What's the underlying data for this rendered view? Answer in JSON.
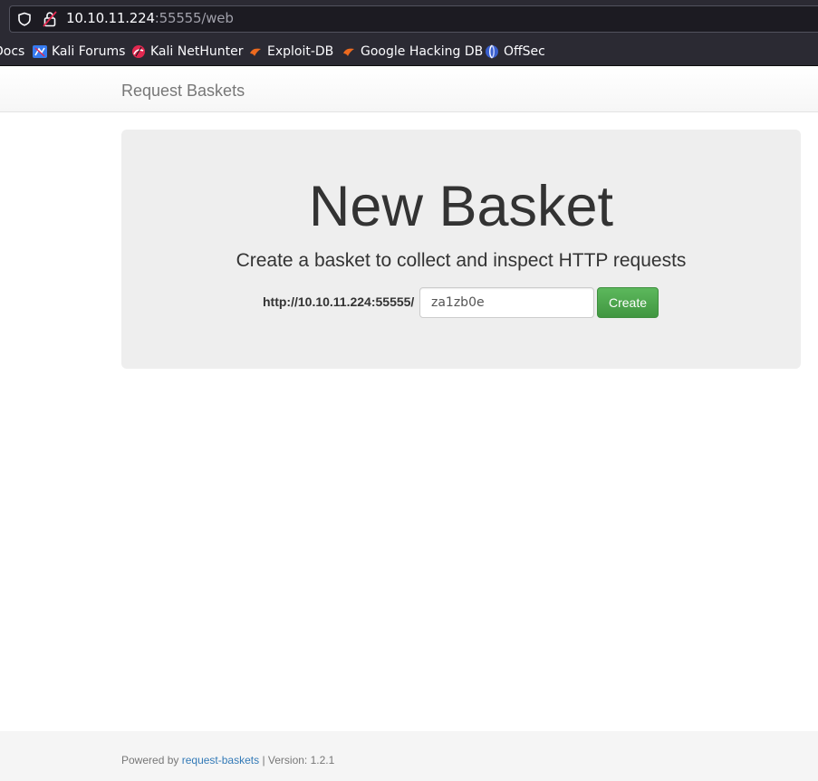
{
  "browser": {
    "url_host": "10.10.11.224",
    "url_rest": ":55555/web",
    "bookmarks": [
      {
        "label": "Docs",
        "icon": "docs-icon"
      },
      {
        "label": "Kali Forums",
        "icon": "kali-forums-icon"
      },
      {
        "label": "Kali NetHunter",
        "icon": "kali-nethunter-icon"
      },
      {
        "label": "Exploit-DB",
        "icon": "exploit-db-icon"
      },
      {
        "label": "Google Hacking DB",
        "icon": "google-hacking-db-icon"
      },
      {
        "label": "OffSec",
        "icon": "offsec-icon"
      }
    ]
  },
  "navbar": {
    "brand": "Request Baskets"
  },
  "jumbotron": {
    "title": "New Basket",
    "lead": "Create a basket to collect and inspect HTTP requests",
    "prefix": "http://10.10.11.224:55555/",
    "basket_name": "za1zb0e",
    "create_label": "Create"
  },
  "footer": {
    "powered_by": "Powered by",
    "link": "request-baskets",
    "version": "| Version: 1.2.1"
  },
  "colors": {
    "chrome_bg": "#2b2a33",
    "urlbar_bg": "#1c1b22",
    "jumbotron_bg": "#eeeeee",
    "create_button": "#5cb85c",
    "link": "#337ab7"
  }
}
